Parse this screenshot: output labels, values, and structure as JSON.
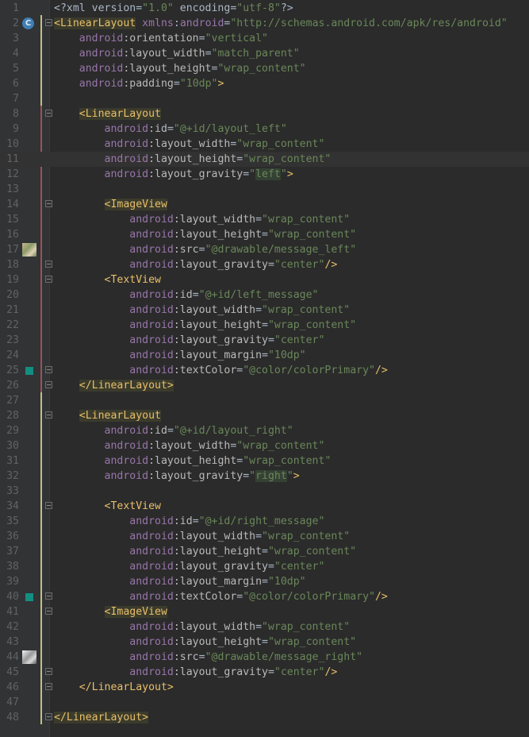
{
  "editor": {
    "colors": {
      "background": "#2B2B2B",
      "gutter": "#313335",
      "tag": "#E8BF6A",
      "attribute": "#BABABA",
      "namespace": "#9876AA",
      "value": "#6A8759",
      "line_number": "#606366"
    },
    "lines": [
      {
        "n": "1",
        "icon": "",
        "parts": [
          [
            "tk-plain",
            "<?xml version="
          ],
          [
            "tk-val",
            "\"1.0\""
          ],
          [
            "tk-plain",
            " encoding="
          ],
          [
            "tk-val",
            "\"utf-8\""
          ],
          [
            "tk-plain",
            "?>"
          ]
        ]
      },
      {
        "n": "2",
        "icon": "class-badge",
        "icon_text": "C",
        "fold": true,
        "parts": [
          [
            "tk-tag hl",
            "<LinearLayout"
          ],
          [
            "tk-plain",
            " "
          ],
          [
            "tk-ns",
            "xmlns"
          ],
          [
            "tk-plain",
            ":"
          ],
          [
            "tk-ns",
            "android"
          ],
          [
            "tk-plain",
            "="
          ],
          [
            "tk-val",
            "\"http://schemas.android.com/apk/res/android\""
          ]
        ]
      },
      {
        "n": "3",
        "parts": [
          [
            "tk-plain",
            "    "
          ],
          [
            "tk-ns",
            "android"
          ],
          [
            "tk-attr",
            ":orientation"
          ],
          [
            "tk-plain",
            "="
          ],
          [
            "tk-val",
            "\"vertical\""
          ]
        ]
      },
      {
        "n": "4",
        "parts": [
          [
            "tk-plain",
            "    "
          ],
          [
            "tk-ns",
            "android"
          ],
          [
            "tk-attr",
            ":layout_width"
          ],
          [
            "tk-plain",
            "="
          ],
          [
            "tk-val",
            "\"match_parent\""
          ]
        ]
      },
      {
        "n": "5",
        "parts": [
          [
            "tk-plain",
            "    "
          ],
          [
            "tk-ns",
            "android"
          ],
          [
            "tk-attr",
            ":layout_height"
          ],
          [
            "tk-plain",
            "="
          ],
          [
            "tk-val",
            "\"wrap_content\""
          ]
        ]
      },
      {
        "n": "6",
        "parts": [
          [
            "tk-plain",
            "    "
          ],
          [
            "tk-ns",
            "android"
          ],
          [
            "tk-attr",
            ":padding"
          ],
          [
            "tk-plain",
            "="
          ],
          [
            "tk-val",
            "\"10dp\""
          ],
          [
            "tk-tag",
            ">"
          ]
        ]
      },
      {
        "n": "7",
        "parts": []
      },
      {
        "n": "8",
        "fold": true,
        "parts": [
          [
            "tk-plain",
            "    "
          ],
          [
            "tk-tag hl",
            "<LinearLayout"
          ]
        ]
      },
      {
        "n": "9",
        "parts": [
          [
            "tk-plain",
            "        "
          ],
          [
            "tk-ns",
            "android"
          ],
          [
            "tk-attr",
            ":id"
          ],
          [
            "tk-plain",
            "="
          ],
          [
            "tk-val",
            "\"@+id/layout_left\""
          ]
        ]
      },
      {
        "n": "10",
        "parts": [
          [
            "tk-plain",
            "        "
          ],
          [
            "tk-ns",
            "android"
          ],
          [
            "tk-attr",
            ":layout_width"
          ],
          [
            "tk-plain",
            "="
          ],
          [
            "tk-val",
            "\"wrap_content\""
          ]
        ]
      },
      {
        "n": "11",
        "caret": true,
        "parts": [
          [
            "tk-plain",
            "        "
          ],
          [
            "tk-ns",
            "android"
          ],
          [
            "tk-attr",
            ":layout_height"
          ],
          [
            "tk-plain",
            "="
          ],
          [
            "tk-val",
            "\"wrap_content\""
          ]
        ]
      },
      {
        "n": "12",
        "parts": [
          [
            "tk-plain",
            "        "
          ],
          [
            "tk-ns",
            "android"
          ],
          [
            "tk-attr",
            ":layout_gravity"
          ],
          [
            "tk-plain",
            "="
          ],
          [
            "tk-val",
            "\""
          ],
          [
            "tk-val hl-val",
            "left"
          ],
          [
            "tk-val",
            "\""
          ],
          [
            "tk-tag",
            ">"
          ]
        ]
      },
      {
        "n": "13",
        "parts": []
      },
      {
        "n": "14",
        "fold": true,
        "parts": [
          [
            "tk-plain",
            "        "
          ],
          [
            "tk-tag hl",
            "<ImageView"
          ]
        ]
      },
      {
        "n": "15",
        "parts": [
          [
            "tk-plain",
            "            "
          ],
          [
            "tk-ns",
            "android"
          ],
          [
            "tk-attr",
            ":layout_width"
          ],
          [
            "tk-plain",
            "="
          ],
          [
            "tk-val",
            "\"wrap_content\""
          ]
        ]
      },
      {
        "n": "16",
        "parts": [
          [
            "tk-plain",
            "            "
          ],
          [
            "tk-ns",
            "android"
          ],
          [
            "tk-attr",
            ":layout_height"
          ],
          [
            "tk-plain",
            "="
          ],
          [
            "tk-val",
            "\"wrap_content\""
          ]
        ]
      },
      {
        "n": "17",
        "icon": "thumb-left",
        "parts": [
          [
            "tk-plain",
            "            "
          ],
          [
            "tk-ns",
            "android"
          ],
          [
            "tk-attr",
            ":src"
          ],
          [
            "tk-plain",
            "="
          ],
          [
            "tk-val",
            "\"@drawable/message_left\""
          ]
        ]
      },
      {
        "n": "18",
        "fold": true,
        "parts": [
          [
            "tk-plain",
            "            "
          ],
          [
            "tk-ns",
            "android"
          ],
          [
            "tk-attr",
            ":layout_gravity"
          ],
          [
            "tk-plain",
            "="
          ],
          [
            "tk-val",
            "\"center\""
          ],
          [
            "tk-tag",
            "/>"
          ]
        ]
      },
      {
        "n": "19",
        "fold": true,
        "parts": [
          [
            "tk-plain",
            "        "
          ],
          [
            "tk-tag",
            "<TextView"
          ]
        ]
      },
      {
        "n": "20",
        "parts": [
          [
            "tk-plain",
            "            "
          ],
          [
            "tk-ns",
            "android"
          ],
          [
            "tk-attr",
            ":id"
          ],
          [
            "tk-plain",
            "="
          ],
          [
            "tk-val",
            "\"@+id/left_message\""
          ]
        ]
      },
      {
        "n": "21",
        "parts": [
          [
            "tk-plain",
            "            "
          ],
          [
            "tk-ns",
            "android"
          ],
          [
            "tk-attr",
            ":layout_width"
          ],
          [
            "tk-plain",
            "="
          ],
          [
            "tk-val",
            "\"wrap_content\""
          ]
        ]
      },
      {
        "n": "22",
        "parts": [
          [
            "tk-plain",
            "            "
          ],
          [
            "tk-ns",
            "android"
          ],
          [
            "tk-attr",
            ":layout_height"
          ],
          [
            "tk-plain",
            "="
          ],
          [
            "tk-val",
            "\"wrap_content\""
          ]
        ]
      },
      {
        "n": "23",
        "parts": [
          [
            "tk-plain",
            "            "
          ],
          [
            "tk-ns",
            "android"
          ],
          [
            "tk-attr",
            ":layout_gravity"
          ],
          [
            "tk-plain",
            "="
          ],
          [
            "tk-val",
            "\"center\""
          ]
        ]
      },
      {
        "n": "24",
        "parts": [
          [
            "tk-plain",
            "            "
          ],
          [
            "tk-ns",
            "android"
          ],
          [
            "tk-attr",
            ":layout_margin"
          ],
          [
            "tk-plain",
            "="
          ],
          [
            "tk-val",
            "\"10dp\""
          ]
        ]
      },
      {
        "n": "25",
        "icon": "color-swatch",
        "fold": true,
        "parts": [
          [
            "tk-plain",
            "            "
          ],
          [
            "tk-ns",
            "android"
          ],
          [
            "tk-attr",
            ":textColor"
          ],
          [
            "tk-plain",
            "="
          ],
          [
            "tk-val",
            "\"@color/colorPrimary\""
          ],
          [
            "tk-tag",
            "/>"
          ]
        ]
      },
      {
        "n": "26",
        "fold": true,
        "parts": [
          [
            "tk-plain",
            "    "
          ],
          [
            "tk-tag hl",
            "</LinearLayout>"
          ]
        ]
      },
      {
        "n": "27",
        "parts": []
      },
      {
        "n": "28",
        "fold": true,
        "parts": [
          [
            "tk-plain",
            "    "
          ],
          [
            "tk-tag hl",
            "<LinearLayout"
          ]
        ]
      },
      {
        "n": "29",
        "parts": [
          [
            "tk-plain",
            "        "
          ],
          [
            "tk-ns",
            "android"
          ],
          [
            "tk-attr",
            ":id"
          ],
          [
            "tk-plain",
            "="
          ],
          [
            "tk-val",
            "\"@+id/layout_right\""
          ]
        ]
      },
      {
        "n": "30",
        "parts": [
          [
            "tk-plain",
            "        "
          ],
          [
            "tk-ns",
            "android"
          ],
          [
            "tk-attr",
            ":layout_width"
          ],
          [
            "tk-plain",
            "="
          ],
          [
            "tk-val",
            "\"wrap_content\""
          ]
        ]
      },
      {
        "n": "31",
        "parts": [
          [
            "tk-plain",
            "        "
          ],
          [
            "tk-ns",
            "android"
          ],
          [
            "tk-attr",
            ":layout_height"
          ],
          [
            "tk-plain",
            "="
          ],
          [
            "tk-val",
            "\"wrap_content\""
          ]
        ]
      },
      {
        "n": "32",
        "parts": [
          [
            "tk-plain",
            "        "
          ],
          [
            "tk-ns",
            "android"
          ],
          [
            "tk-attr",
            ":layout_gravity"
          ],
          [
            "tk-plain",
            "="
          ],
          [
            "tk-val",
            "\""
          ],
          [
            "tk-val hl-val",
            "right"
          ],
          [
            "tk-val",
            "\""
          ],
          [
            "tk-tag",
            ">"
          ]
        ]
      },
      {
        "n": "33",
        "parts": []
      },
      {
        "n": "34",
        "fold": true,
        "parts": [
          [
            "tk-plain",
            "        "
          ],
          [
            "tk-tag",
            "<TextView"
          ]
        ]
      },
      {
        "n": "35",
        "parts": [
          [
            "tk-plain",
            "            "
          ],
          [
            "tk-ns",
            "android"
          ],
          [
            "tk-attr",
            ":id"
          ],
          [
            "tk-plain",
            "="
          ],
          [
            "tk-val",
            "\"@+id/right_message\""
          ]
        ]
      },
      {
        "n": "36",
        "parts": [
          [
            "tk-plain",
            "            "
          ],
          [
            "tk-ns",
            "android"
          ],
          [
            "tk-attr",
            ":layout_width"
          ],
          [
            "tk-plain",
            "="
          ],
          [
            "tk-val",
            "\"wrap_content\""
          ]
        ]
      },
      {
        "n": "37",
        "parts": [
          [
            "tk-plain",
            "            "
          ],
          [
            "tk-ns",
            "android"
          ],
          [
            "tk-attr",
            ":layout_height"
          ],
          [
            "tk-plain",
            "="
          ],
          [
            "tk-val",
            "\"wrap_content\""
          ]
        ]
      },
      {
        "n": "38",
        "parts": [
          [
            "tk-plain",
            "            "
          ],
          [
            "tk-ns",
            "android"
          ],
          [
            "tk-attr",
            ":layout_gravity"
          ],
          [
            "tk-plain",
            "="
          ],
          [
            "tk-val",
            "\"center\""
          ]
        ]
      },
      {
        "n": "39",
        "parts": [
          [
            "tk-plain",
            "            "
          ],
          [
            "tk-ns",
            "android"
          ],
          [
            "tk-attr",
            ":layout_margin"
          ],
          [
            "tk-plain",
            "="
          ],
          [
            "tk-val",
            "\"10dp\""
          ]
        ]
      },
      {
        "n": "40",
        "icon": "color-swatch",
        "fold": true,
        "parts": [
          [
            "tk-plain",
            "            "
          ],
          [
            "tk-ns",
            "android"
          ],
          [
            "tk-attr",
            ":textColor"
          ],
          [
            "tk-plain",
            "="
          ],
          [
            "tk-val",
            "\"@color/colorPrimary\""
          ],
          [
            "tk-tag",
            "/>"
          ]
        ]
      },
      {
        "n": "41",
        "fold": true,
        "parts": [
          [
            "tk-plain",
            "        "
          ],
          [
            "tk-tag hl",
            "<ImageView"
          ]
        ]
      },
      {
        "n": "42",
        "parts": [
          [
            "tk-plain",
            "            "
          ],
          [
            "tk-ns",
            "android"
          ],
          [
            "tk-attr",
            ":layout_width"
          ],
          [
            "tk-plain",
            "="
          ],
          [
            "tk-val",
            "\"wrap_content\""
          ]
        ]
      },
      {
        "n": "43",
        "parts": [
          [
            "tk-plain",
            "            "
          ],
          [
            "tk-ns",
            "android"
          ],
          [
            "tk-attr",
            ":layout_height"
          ],
          [
            "tk-plain",
            "="
          ],
          [
            "tk-val",
            "\"wrap_content\""
          ]
        ]
      },
      {
        "n": "44",
        "icon": "thumb-right",
        "parts": [
          [
            "tk-plain",
            "            "
          ],
          [
            "tk-ns",
            "android"
          ],
          [
            "tk-attr",
            ":src"
          ],
          [
            "tk-plain",
            "="
          ],
          [
            "tk-val",
            "\"@drawable/message_right\""
          ]
        ]
      },
      {
        "n": "45",
        "fold": true,
        "parts": [
          [
            "tk-plain",
            "            "
          ],
          [
            "tk-ns",
            "android"
          ],
          [
            "tk-attr",
            ":layout_gravity"
          ],
          [
            "tk-plain",
            "="
          ],
          [
            "tk-val",
            "\"center\""
          ],
          [
            "tk-tag",
            "/>"
          ]
        ]
      },
      {
        "n": "46",
        "fold": true,
        "parts": [
          [
            "tk-plain",
            "    "
          ],
          [
            "tk-tag",
            "</LinearLayout>"
          ]
        ]
      },
      {
        "n": "47",
        "parts": []
      },
      {
        "n": "48",
        "fold": true,
        "parts": [
          [
            "tk-tag hl",
            "</LinearLayout>"
          ]
        ]
      }
    ]
  }
}
